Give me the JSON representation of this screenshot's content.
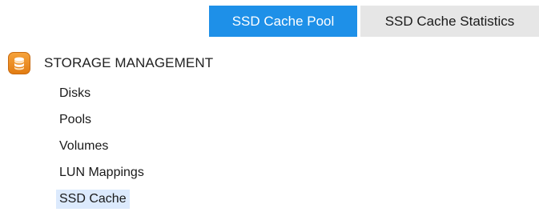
{
  "tabs": [
    {
      "label": "SSD Cache Pool",
      "active": true
    },
    {
      "label": "SSD Cache Statistics",
      "active": false
    }
  ],
  "tree": {
    "title": "STORAGE MANAGEMENT",
    "icon": "storage-database-icon",
    "items": [
      {
        "label": "Disks"
      },
      {
        "label": "Pools"
      },
      {
        "label": "Volumes"
      },
      {
        "label": "LUN Mappings"
      },
      {
        "label": "SSD Cache",
        "selected": true
      }
    ]
  },
  "colors": {
    "active_tab": "#1e90e8",
    "inactive_tab": "#e6e6e6",
    "selected_item": "#dceafd",
    "icon_orange": "#f0952a"
  }
}
